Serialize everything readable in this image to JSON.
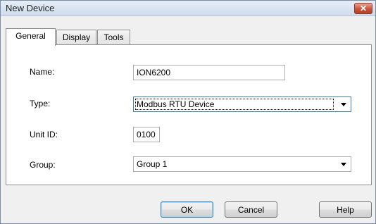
{
  "window": {
    "title": "New Device"
  },
  "tabs": [
    {
      "label": "General"
    },
    {
      "label": "Display"
    },
    {
      "label": "Tools"
    }
  ],
  "form": {
    "name_label": "Name:",
    "name_value": "ION6200",
    "type_label": "Type:",
    "type_value": "Modbus RTU Device",
    "unit_id_label": "Unit ID:",
    "unit_id_value": "0100",
    "group_label": "Group:",
    "group_value": "Group 1"
  },
  "buttons": {
    "ok": "OK",
    "cancel": "Cancel",
    "help": "Help"
  },
  "icons": {
    "close": "close-icon",
    "dropdown": "chevron-down-icon"
  }
}
